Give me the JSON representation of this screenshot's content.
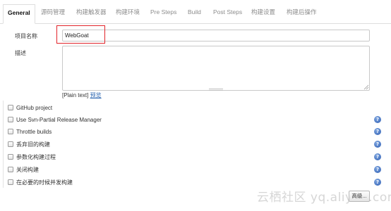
{
  "tabs": [
    {
      "label": "General"
    },
    {
      "label": "源码管理"
    },
    {
      "label": "构建触发器"
    },
    {
      "label": "构建环境"
    },
    {
      "label": "Pre Steps"
    },
    {
      "label": "Build"
    },
    {
      "label": "Post Steps"
    },
    {
      "label": "构建设置"
    },
    {
      "label": "构建后操作"
    }
  ],
  "form": {
    "name_label": "项目名称",
    "name_value": "WebGoat",
    "desc_label": "描述",
    "desc_value": "",
    "plain_text": "[Plain text]",
    "preview_link": "预览"
  },
  "options": [
    {
      "label": "GitHub project",
      "checked": false,
      "help": false
    },
    {
      "label": "Use Svn-Partial Release Manager",
      "checked": false,
      "help": true
    },
    {
      "label": "Throttle builds",
      "checked": false,
      "help": true
    },
    {
      "label": "丢弃旧的构建",
      "checked": false,
      "help": true
    },
    {
      "label": "参数化构建过程",
      "checked": false,
      "help": true
    },
    {
      "label": "关闭构建",
      "checked": false,
      "help": true
    },
    {
      "label": "在必要的时候并发构建",
      "checked": false,
      "help": true
    }
  ],
  "help_glyph": "?",
  "advanced_label": "高级...",
  "watermark": "云栖社区 yq.aliyun.com",
  "colors": {
    "highlight": "#e2242a",
    "link": "#2a64b0",
    "help_icon": "#2f5fb3"
  },
  "icons": {
    "help": "question-mark-circle-icon",
    "resize": "resize-grip-icon"
  }
}
